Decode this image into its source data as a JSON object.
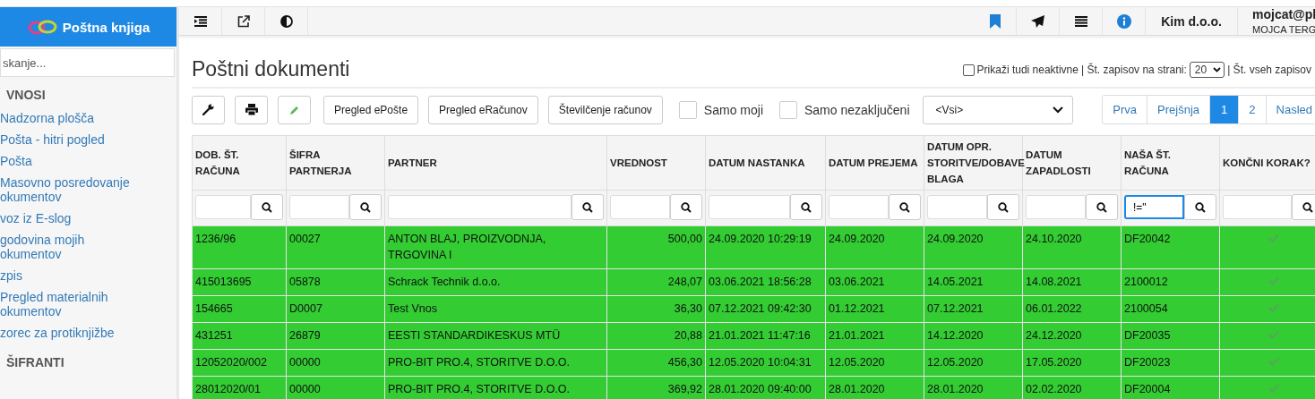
{
  "brand": {
    "title": "Poštna knjiga"
  },
  "sidebar": {
    "search": {
      "placeholder": "skanje..."
    },
    "sections": [
      {
        "title": "VNOSI",
        "items": [
          {
            "label": "Nadzorna plošča"
          },
          {
            "label": "Pošta - hitri pogled"
          },
          {
            "label": "Pošta"
          },
          {
            "label": "Masovno posredovanje okumentov"
          },
          {
            "label": "voz iz E-slog"
          },
          {
            "label": "godovina mojih okumentov"
          },
          {
            "label": "zpis"
          },
          {
            "label": "Pregled materialnih okumentov"
          },
          {
            "label": "zorec za protiknjižbe"
          }
        ]
      },
      {
        "title": "ŠIFRANTI"
      }
    ]
  },
  "topbar": {
    "company": "Kim d.o.o.",
    "user": "mojcat@pl",
    "user_name": "MOJCA TERG"
  },
  "page": {
    "title": "Poštni dokumenti",
    "show_inactive": {
      "label": "Prikaži tudi neaktivne",
      "checked": false
    },
    "per_page_label": "| Št. zapisov na strani:",
    "per_page": "20",
    "total_label": "| Št. vseh zapisov"
  },
  "toolbar": {
    "buttons": [
      "Pregled ePošte",
      "Pregled eRačunov",
      "Številčenje računov"
    ],
    "filters": [
      {
        "label": "Samo moji",
        "checked": false
      },
      {
        "label": "Samo nezaključeni",
        "checked": false
      }
    ],
    "status_select": "<Vsi>"
  },
  "pagination": [
    {
      "label": "Prva",
      "selected": false
    },
    {
      "label": "Prejšnja",
      "selected": false
    },
    {
      "label": "1",
      "selected": true
    },
    {
      "label": "2",
      "selected": false
    },
    {
      "label": "Nasled",
      "selected": false
    }
  ],
  "table": {
    "columns": [
      {
        "title": "DOB. ŠT. RAČUNA",
        "kind": "text"
      },
      {
        "title": "ŠIFRA PARTNERJA",
        "kind": "text"
      },
      {
        "title": "PARTNER",
        "kind": "text"
      },
      {
        "title": "VREDNOST",
        "kind": "number"
      },
      {
        "title": "DATUM NASTANKA",
        "kind": "text"
      },
      {
        "title": "DATUM PREJEMA",
        "kind": "text"
      },
      {
        "title": "DATUM OPR. STORITVE/DOBAVE BLAGA",
        "kind": "text"
      },
      {
        "title": "DATUM ZAPADLOSTI",
        "kind": "text"
      },
      {
        "title": "NAŠA ŠT. RAČUNA",
        "kind": "text",
        "filter_value": "!=\""
      },
      {
        "title": "KONČNI KORAK?",
        "kind": "check"
      }
    ],
    "rows": [
      {
        "cells": [
          "1236/96",
          "00027",
          "ANTON BLAJ, PROIZVODNJA, TRGOVINA I",
          "500,00",
          "24.09.2020 10:29:19",
          "24.09.2020",
          "24.09.2020",
          "24.10.2020",
          "DF20042"
        ],
        "final_step": true
      },
      {
        "cells": [
          "415013695",
          "05878",
          "Schrack Technik d.o.o.",
          "248,07",
          "03.06.2021 18:56:28",
          "03.06.2021",
          "14.05.2021",
          "14.08.2021",
          "2100012"
        ],
        "final_step": true
      },
      {
        "cells": [
          "154665",
          "D0007",
          "Test Vnos",
          "36,30",
          "07.12.2021 09:42:30",
          "01.12.2021",
          "07.12.2021",
          "06.01.2022",
          "2100054"
        ],
        "final_step": true
      },
      {
        "cells": [
          "431251",
          "26879",
          "EESTI STANDARDIKESKUS MTÜ",
          "20,88",
          "21.01.2021 11:47:16",
          "21.01.2021",
          "14.12.2020",
          "24.12.2020",
          "DF20035"
        ],
        "final_step": true
      },
      {
        "cells": [
          "12052020/002",
          "00000",
          "PRO-BIT PRO.4, STORITVE D.O.O.",
          "456,30",
          "12.05.2020 10:04:31",
          "12.05.2020",
          "12.05.2020",
          "17.05.2020",
          "DF20023"
        ],
        "final_step": true
      },
      {
        "cells": [
          "28012020/01",
          "00000",
          "PRO-BIT PRO.4, STORITVE D.O.O.",
          "369,92",
          "28.01.2020 09:40:00",
          "28.01.2020",
          "28.01.2020",
          "02.02.2020",
          "DF20004"
        ],
        "final_step": true
      }
    ]
  }
}
